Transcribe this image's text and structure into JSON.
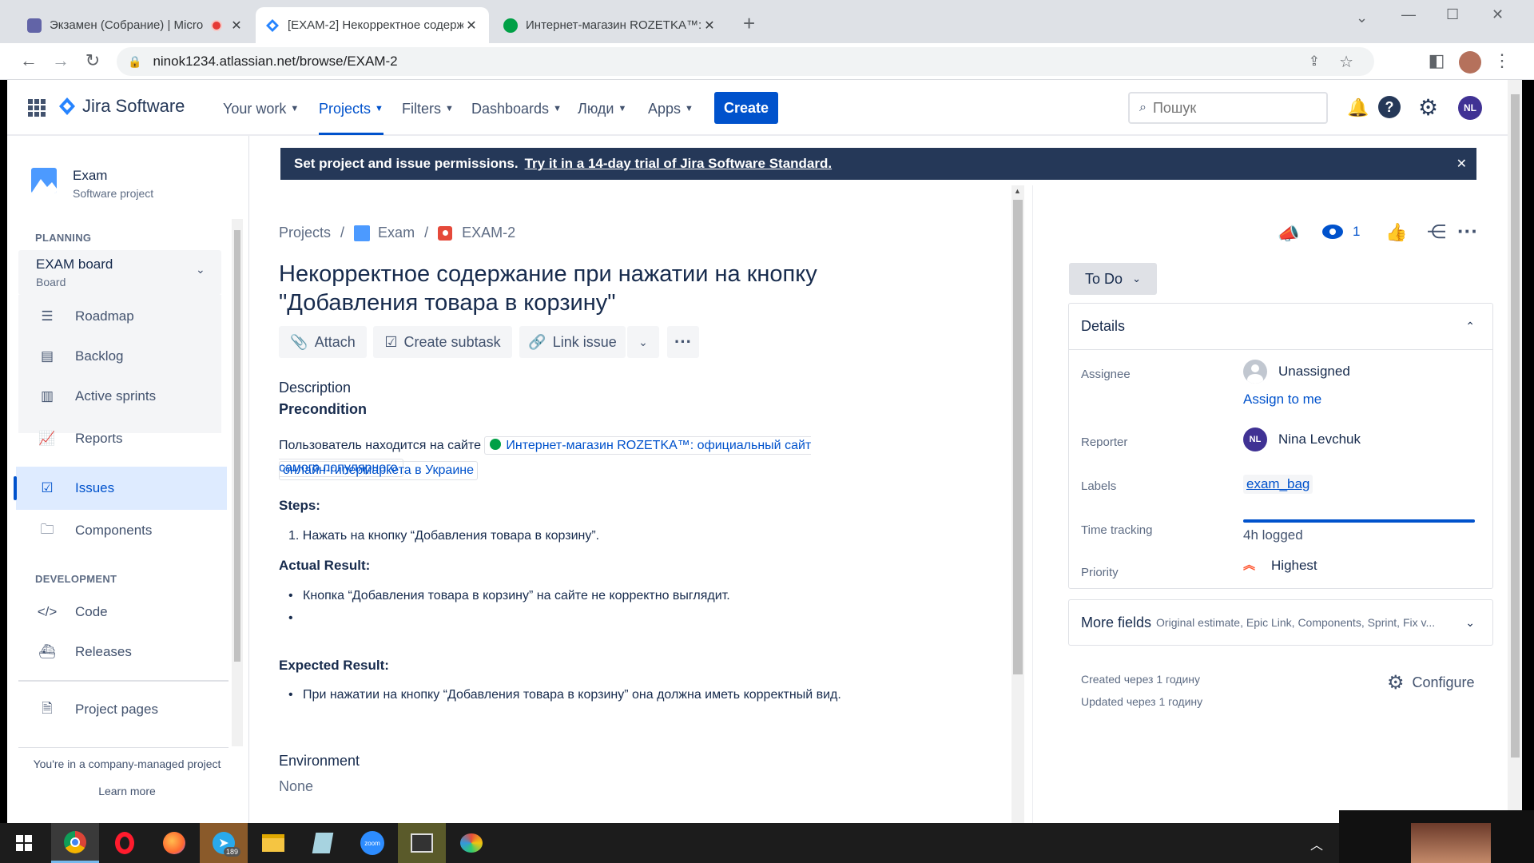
{
  "browser": {
    "tabs": [
      {
        "title": "Экзамен (Собрание) | Micro",
        "icon": "teams-icon",
        "active": false
      },
      {
        "title": "[EXAM-2] Некорректное содерж",
        "icon": "jira-icon",
        "active": true
      },
      {
        "title": "Интернет-магазин ROZETKA™: с",
        "icon": "rozetka-icon",
        "active": false
      }
    ],
    "url": "ninok1234.atlassian.net/browse/EXAM-2"
  },
  "jira_nav": {
    "product": "Jira Software",
    "menu": [
      "Your work",
      "Projects",
      "Filters",
      "Dashboards",
      "Люди",
      "Apps"
    ],
    "create": "Create",
    "search_placeholder": "Пошук",
    "avatar": "NL"
  },
  "sidebar": {
    "project_name": "Exam",
    "project_type": "Software project",
    "planning_heading": "PLANNING",
    "board_name": "EXAM board",
    "board_type": "Board",
    "planning_items": [
      "Roadmap",
      "Backlog",
      "Active sprints",
      "Reports"
    ],
    "issues_label": "Issues",
    "components_label": "Components",
    "development_heading": "DEVELOPMENT",
    "dev_items": [
      "Code",
      "Releases"
    ],
    "project_pages": "Project pages",
    "footer_text": "You're in a company-managed project",
    "learn_more": "Learn more"
  },
  "banner": {
    "text": "Set project and issue permissions.",
    "link": "Try it in a 14-day trial of Jira Software Standard."
  },
  "issue": {
    "breadcrumb": [
      "Projects",
      "Exam",
      "EXAM-2"
    ],
    "title_line1": "Некорректное содержание при нажатии на кнопку",
    "title_line2": "\"Добавления товара в корзину\"",
    "actions": {
      "attach": "Attach",
      "subtask": "Create subtask",
      "link": "Link issue"
    },
    "description_label": "Description",
    "precondition": "Precondition",
    "precondition_text": "Пользователь находится на сайте",
    "link_line1": "Интернет-магазин ROZETKA™: официальный сайт самого популярного",
    "link_line2": "онлайн-гипермаркета в Украине",
    "steps_label": "Steps:",
    "step1": "1. Нажать на кнопку  “Добавления товара в корзину”.",
    "actual_label": "Actual Result:",
    "actual1": "Кнопка “Добавления товара в корзину” на сайте не  корректно выглядит.",
    "expected_label": "Expected Result:",
    "expected1": "При нажатии на кнопку “Добавления товара в корзину” она должна иметь корректный вид.",
    "environment_label": "Environment",
    "environment_value": "None"
  },
  "details": {
    "watchers": "1",
    "status": "To Do",
    "heading": "Details",
    "assignee_label": "Assignee",
    "assignee": "Unassigned",
    "assign_to_me": "Assign to me",
    "reporter_label": "Reporter",
    "reporter": "Nina Levchuk",
    "reporter_initials": "NL",
    "labels_label": "Labels",
    "label_value": "exam_bag",
    "time_label": "Time tracking",
    "time_value": "4h logged",
    "time_fill": 1.0,
    "priority_label": "Priority",
    "priority": "Highest",
    "more_fields": "More fields",
    "more_fields_hint": "Original estimate, Epic Link, Components, Sprint, Fix v...",
    "created": "Created через 1 годину",
    "updated": "Updated через 1 годину",
    "configure": "Configure",
    "colors": {
      "accent": "#0052cc",
      "priority": "#ff5630",
      "banner": "#253858"
    }
  },
  "taskbar": {
    "telegram_badge": "189",
    "apps": [
      "windows-start-icon",
      "chrome-icon",
      "opera-icon",
      "firefox-icon",
      "telegram-icon",
      "file-explorer-icon",
      "notepad-icon",
      "zoom-icon",
      "video-editor-icon",
      "paint-icon"
    ]
  }
}
